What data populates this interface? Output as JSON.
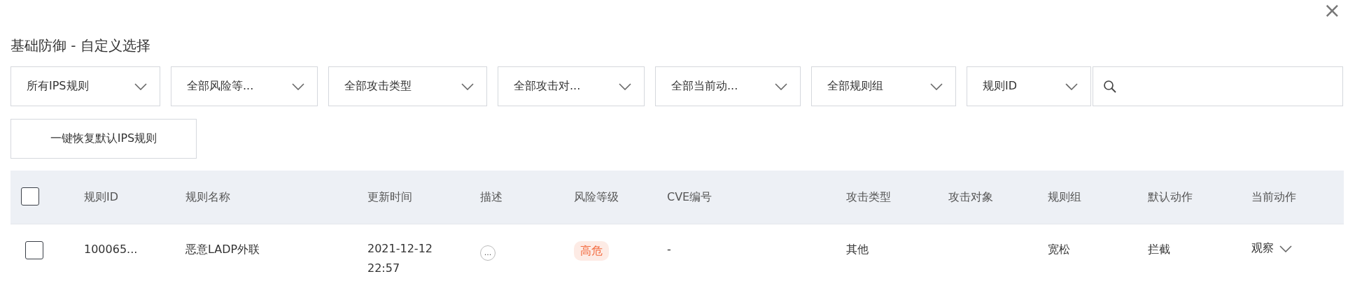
{
  "dialog": {
    "title": "基础防御 - 自定义选择",
    "close": "×"
  },
  "filters": [
    {
      "label": "所有IPS规则"
    },
    {
      "label": "全部风险等..."
    },
    {
      "label": "全部攻击类型"
    },
    {
      "label": "全部攻击对..."
    },
    {
      "label": "全部当前动..."
    },
    {
      "label": "全部规则组"
    },
    {
      "label": "规则ID"
    }
  ],
  "reset_button": "一键恢复默认IPS规则",
  "table": {
    "select_all": {
      "checked": false
    },
    "columns": [
      "规则ID",
      "规则名称",
      "更新时间",
      "描述",
      "风险等级",
      "CVE编号",
      "攻击类型",
      "攻击对象",
      "规则组",
      "默认动作",
      "当前动作"
    ],
    "rows": [
      {
        "checked": false,
        "rule_id": "100065...",
        "name": "恶意LADP外联",
        "updated": [
          "2021-12-12",
          "22:57"
        ],
        "description": "...",
        "risk": {
          "label": "高危",
          "color": "#f36b3f"
        },
        "cve": "-",
        "attack_type": "其他",
        "group": "宽松",
        "default_action": "拦截",
        "current_action": "观察"
      }
    ]
  }
}
